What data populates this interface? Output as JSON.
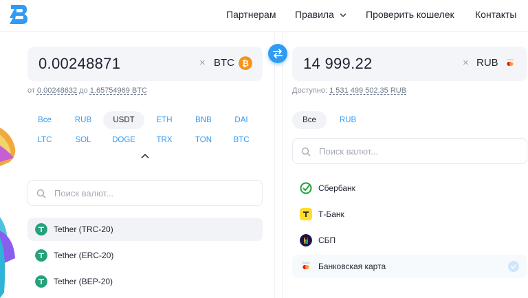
{
  "header": {
    "nav": [
      {
        "label": "Партнерам"
      },
      {
        "label": "Правила"
      },
      {
        "label": "Проверить кошелек"
      },
      {
        "label": "Контакты"
      }
    ]
  },
  "give": {
    "amount": "0.00248871",
    "currency": "BTC",
    "limits_prefix": "от",
    "min": "0.00248632",
    "limits_mid": "до",
    "max": "1.65754969 BTC",
    "filters": [
      "Все",
      "RUB",
      "USDT",
      "ETH",
      "BNB",
      "DAI",
      "LTC",
      "SOL",
      "DOGE",
      "TRX",
      "TON",
      "BTC"
    ],
    "active_filter": "USDT",
    "search_placeholder": "Поиск валют...",
    "items": [
      {
        "label": "Tether (TRC-20)",
        "selected": true
      },
      {
        "label": "Tether (ERC-20)",
        "selected": false
      },
      {
        "label": "Tether (BEP-20)",
        "selected": false
      }
    ]
  },
  "get": {
    "amount": "14 999.22",
    "currency": "RUB",
    "available_label": "Доступно:",
    "available": "1 531 499 502.35 RUB",
    "filters": [
      "Все",
      "RUB"
    ],
    "active_filter": "Все",
    "search_placeholder": "Поиск валют...",
    "items": [
      {
        "label": "Сбербанк",
        "icon": "sberbank-icon"
      },
      {
        "label": "Т-Банк",
        "icon": "tbank-icon"
      },
      {
        "label": "СБП",
        "icon": "sbp-icon"
      },
      {
        "label": "Банковская карта",
        "icon": "bank-card-icon",
        "selected": true
      }
    ]
  },
  "colors": {
    "accent": "#2f9bf4",
    "btc": "#f7931a",
    "tether": "#26a17b",
    "sber": "#21a038",
    "tbank": "#ffdd2d"
  }
}
